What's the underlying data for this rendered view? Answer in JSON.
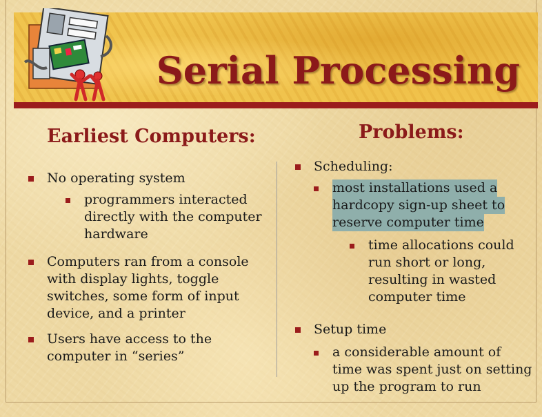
{
  "slide": {
    "title": "Serial Processing"
  },
  "left_column": {
    "heading": "Earliest Computers:",
    "items": [
      {
        "lines": [
          "No operating system"
        ]
      },
      {
        "lines": [
          "programmers interacted",
          "directly with the computer",
          "hardware"
        ]
      },
      {
        "lines": [
          "Computers ran from a console",
          "with display lights, toggle",
          "switches, some form of input",
          "device, and a printer"
        ]
      },
      {
        "lines": [
          "Users have access to the",
          "computer in “series”"
        ]
      }
    ]
  },
  "right_column": {
    "heading": "Problems:",
    "items": [
      {
        "lines": [
          "Scheduling:"
        ]
      },
      {
        "lines": [
          "most installations used a",
          "hardcopy sign-up sheet to",
          "reserve computer time"
        ]
      },
      {
        "lines": [
          "time allocations could",
          "run short or long,",
          "resulting in wasted",
          "computer time"
        ]
      },
      {
        "lines": [
          "Setup time"
        ]
      },
      {
        "lines": [
          "a considerable amount of",
          "time was spent just on setting",
          "up the program to run"
        ]
      }
    ]
  },
  "icons": {
    "clipart": "computer-repair-clipart-icon",
    "bullet": "square-bullet-icon"
  },
  "colors": {
    "title": "#8b1a1a",
    "bullet": "#9b1c1c",
    "highlight": "#8fafab",
    "header_band": "#f0c44e"
  }
}
